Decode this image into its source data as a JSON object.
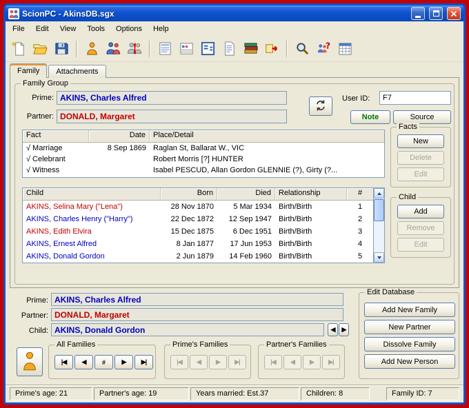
{
  "window": {
    "title": "ScionPC - AkinsDB.sgx"
  },
  "menu": {
    "items": [
      "File",
      "Edit",
      "View",
      "Tools",
      "Options",
      "Help"
    ]
  },
  "toolbar": {
    "icons": [
      "new-document",
      "open-database",
      "save-database",
      "person",
      "add-family",
      "split-family",
      "report-list",
      "family-group-sheet",
      "pedigree-chart",
      "document-notes",
      "source-books",
      "export-gedcom",
      "search",
      "person-search",
      "calendar"
    ]
  },
  "tabs": {
    "family": "Family",
    "attachments": "Attachments"
  },
  "family_group": {
    "label": "Family Group",
    "prime_label": "Prime:",
    "prime_value": "AKINS, Charles Alfred",
    "partner_label": "Partner:",
    "partner_value": "DONALD, Margaret",
    "user_id_label": "User ID:",
    "user_id_value": "F7",
    "note_button": "Note",
    "source_button": "Source"
  },
  "facts": {
    "label": "Facts",
    "headers": {
      "fact": "Fact",
      "date": "Date",
      "detail": "Place/Detail"
    },
    "rows": [
      {
        "check": "√",
        "fact": "Marriage",
        "date": "8 Sep 1869",
        "detail": "Raglan St, Ballarat W., VIC"
      },
      {
        "check": "√",
        "fact": "Celebrant",
        "date": "",
        "detail": "Robert Morris [?] HUNTER"
      },
      {
        "check": "√",
        "fact": "Witness",
        "date": "",
        "detail": "Isabel PESCUD, Allan Gordon GLENNIE (?), Girty (?..."
      }
    ],
    "buttons": {
      "new": "New",
      "delete": "Delete",
      "edit": "Edit"
    }
  },
  "children": {
    "label": "Child",
    "headers": {
      "name": "Child",
      "born": "Born",
      "died": "Died",
      "rel": "Relationship",
      "num": "#"
    },
    "rows": [
      {
        "name": "AKINS, Selina Mary (\"Lena\")",
        "born": "28 Nov 1870",
        "died": "5 Mar 1934",
        "rel": "Birth/Birth",
        "num": "1",
        "color": "#C00000"
      },
      {
        "name": "AKINS, Charles Henry (\"Harry\")",
        "born": "22 Dec 1872",
        "died": "12 Sep 1947",
        "rel": "Birth/Birth",
        "num": "2",
        "color": "#0000C0"
      },
      {
        "name": "AKINS, Edith Elvira",
        "born": "15 Dec 1875",
        "died": "6 Dec 1951",
        "rel": "Birth/Birth",
        "num": "3",
        "color": "#C00000"
      },
      {
        "name": "AKINS, Ernest Alfred",
        "born": "8 Jan 1877",
        "died": "17 Jun 1953",
        "rel": "Birth/Birth",
        "num": "4",
        "color": "#0000C0"
      },
      {
        "name": "AKINS, Donald Gordon",
        "born": "2 Jun 1879",
        "died": "14 Feb 1960",
        "rel": "Birth/Birth",
        "num": "5",
        "color": "#0000C0"
      }
    ],
    "buttons": {
      "add": "Add",
      "remove": "Remove",
      "edit": "Edit"
    }
  },
  "summary": {
    "prime_label": "Prime:",
    "prime_value": "AKINS, Charles Alfred",
    "partner_label": "Partner:",
    "partner_value": "DONALD, Margaret",
    "child_label": "Child:",
    "child_value": "AKINS, Donald Gordon"
  },
  "navigation": {
    "all_families_label": "All Families",
    "primes_families_label": "Prime's Families",
    "partners_families_label": "Partner's Families",
    "first": "|◀",
    "prev": "◀",
    "goto": "#",
    "next": "▶",
    "last": "▶|",
    "child_prev": "◀",
    "child_next": "▶"
  },
  "edit_database": {
    "label": "Edit Database",
    "buttons": {
      "add_family": "Add New Family",
      "new_partner": "New Partner",
      "dissolve": "Dissolve Family",
      "add_person": "Add New Person"
    }
  },
  "status_bar": {
    "prime_age": "Prime's age: 21",
    "partner_age": "Partner's age: 19",
    "years_married": "Years married: Est.37",
    "children": "Children: 8",
    "family_id": "Family ID: 7"
  },
  "colors": {
    "male": "#0000C0",
    "female": "#C00000",
    "note_green": "#007000",
    "titlebar_blue": "#0A52CE",
    "desktop_red": "#C00404",
    "window_face": "#ECE9D8"
  }
}
